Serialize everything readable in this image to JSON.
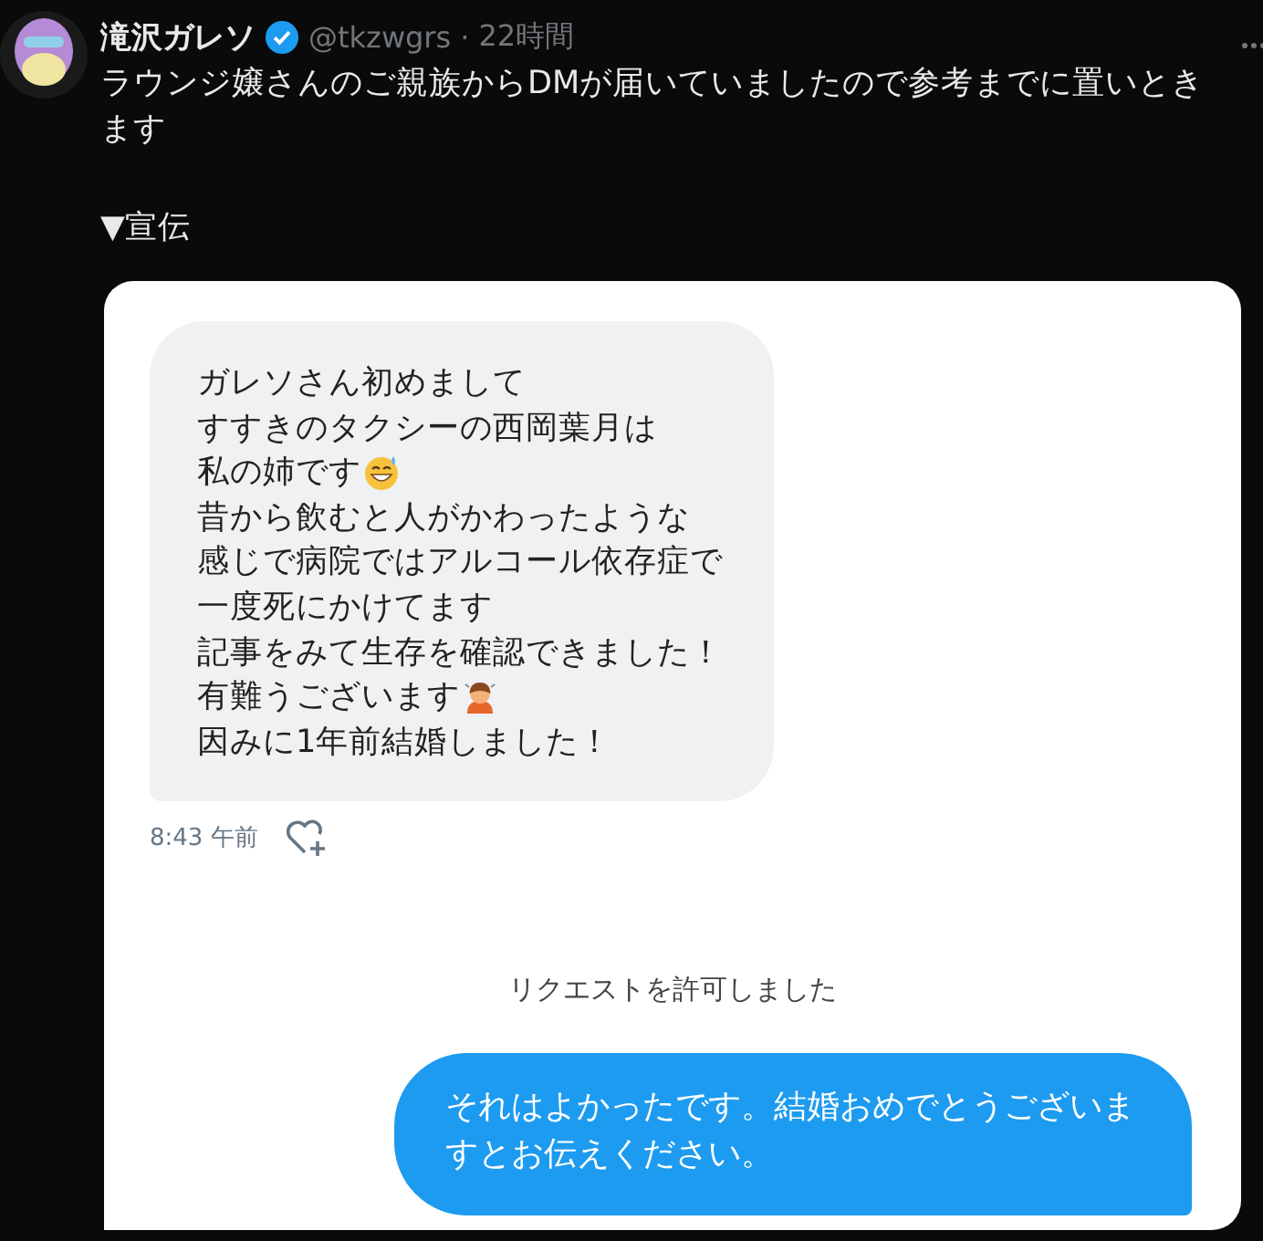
{
  "post": {
    "author": "滝沢ガレソ",
    "verified": true,
    "handle": "@tkzwgrs",
    "separator": "·",
    "time": "22時間",
    "text": "ラウンジ嬢さんのご親族からDMが届いていましたので参考までに置いときます",
    "tag": "▼宣伝"
  },
  "dm": {
    "received_lines": [
      {
        "kind": "text",
        "text": "ガレソさん初めまして"
      },
      {
        "kind": "text",
        "text": "すすきのタクシーの西岡葉月は"
      },
      {
        "kind": "sweatsmile",
        "text": "私の姉です"
      },
      {
        "kind": "text",
        "text": "昔から飲むと人がかわったような"
      },
      {
        "kind": "text",
        "text": "感じで病院ではアルコール依存症で"
      },
      {
        "kind": "text",
        "text": "一度死にかけてます"
      },
      {
        "kind": "text",
        "text": "記事をみて生存を確認できました！"
      },
      {
        "kind": "bowing",
        "text": "有難うございます"
      },
      {
        "kind": "text",
        "text": "因みに1年前結婚しました！"
      }
    ],
    "received_time": "8:43 午前",
    "notice": "リクエストを許可しました",
    "sent_text": "それはよかったです。結婚おめでとうございますとお伝えください。"
  }
}
